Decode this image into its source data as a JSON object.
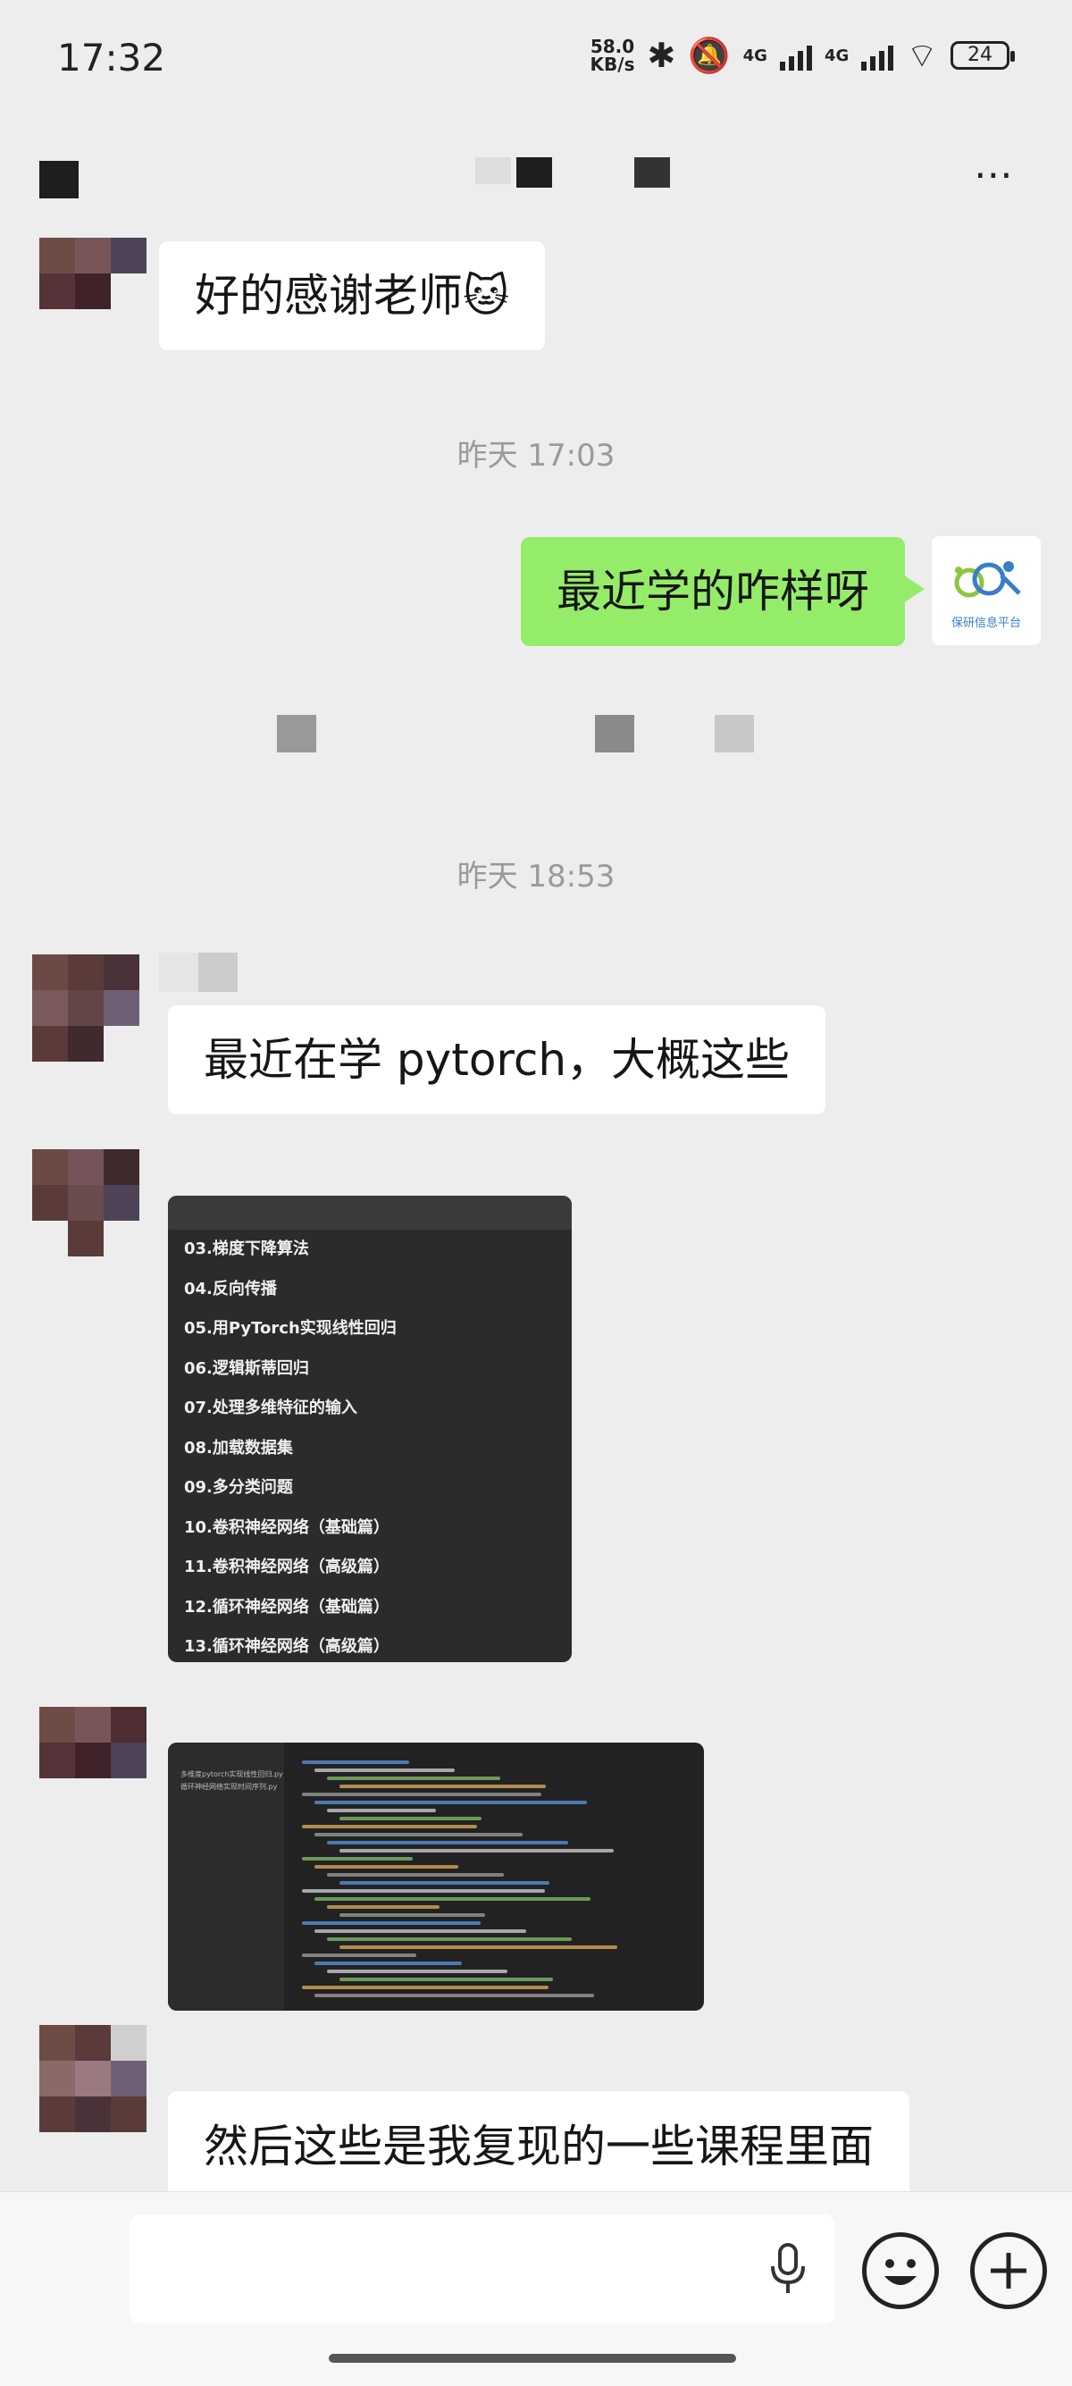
{
  "status_bar": {
    "time": "17:32",
    "net_speed_value": "58.0",
    "net_speed_unit": "KB/s",
    "net_1": "4G",
    "net_2": "4G",
    "battery": "24",
    "icons": [
      "bluetooth-icon",
      "mute-icon",
      "signal-icon",
      "wifi-icon",
      "battery-icon"
    ]
  },
  "header": {
    "more_icon": "⋯"
  },
  "messages": [
    {
      "id": "m1",
      "sender": "other",
      "text": "好的感谢老师🐱"
    },
    {
      "id": "t1",
      "type": "time",
      "text": "昨天 17:03"
    },
    {
      "id": "m2",
      "sender": "me",
      "text": "最近学的咋样呀"
    },
    {
      "id": "t2",
      "type": "time",
      "text": "昨天 18:53"
    },
    {
      "id": "m3",
      "sender": "other",
      "text": "最近在学 pytorch，大概这些"
    },
    {
      "id": "m4",
      "sender": "other",
      "type": "image"
    },
    {
      "id": "m5",
      "sender": "other",
      "type": "image"
    },
    {
      "id": "m6",
      "sender": "other",
      "text": "然后这些是我复现的一些课程里面"
    }
  ],
  "my_avatar_label": "保研信息平台",
  "course_list": [
    "03.梯度下降算法",
    "04.反向传播",
    "05.用PyTorch实现线性回归",
    "06.逻辑斯蒂回归",
    "07.处理多维特征的输入",
    "08.加载数据集",
    "09.多分类问题",
    "10.卷积神经网络（基础篇）",
    "11.卷积神经网络（高级篇）",
    "12.循环神经网络（基础篇）",
    "13.循环神经网络（高级篇）"
  ],
  "code_panel": {
    "files": [
      "多维度pytorch实现线性回归.py",
      "循环神经网络实现时间序列.py"
    ]
  },
  "input_bar": {
    "voice_icon": "microphone-icon",
    "emoji_icon": "emoji-icon",
    "plus_icon": "plus-icon"
  },
  "colors": {
    "bg": "#ededed",
    "me_bubble": "#95ec69",
    "other_bubble": "#ffffff",
    "time_text": "#9a9a9a"
  }
}
